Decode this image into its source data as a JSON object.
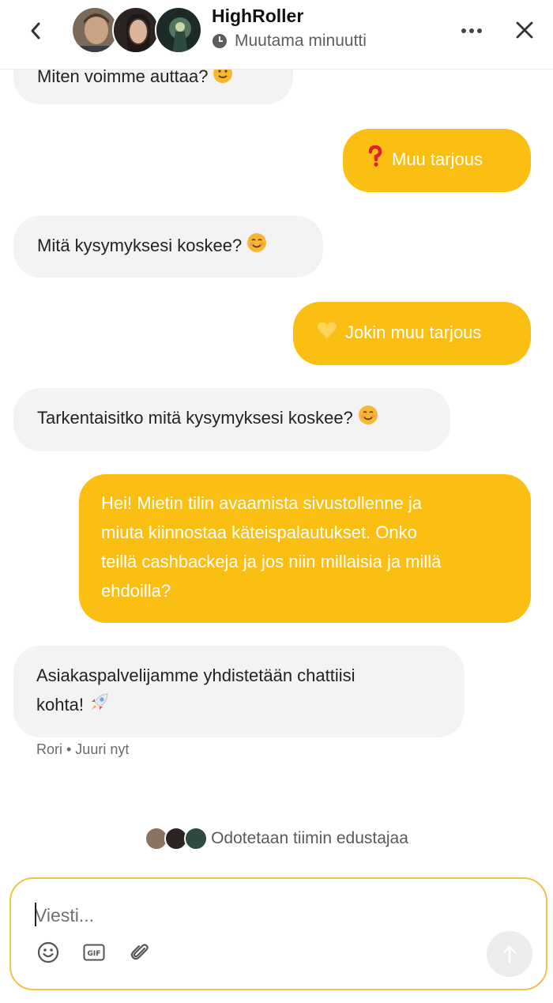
{
  "header": {
    "title": "HighRoller",
    "status": "Muutama minuutti",
    "icons": [
      "chevron-left-icon",
      "clock-icon",
      "more-horizontal-icon",
      "close-icon"
    ]
  },
  "messages": [
    {
      "from": "bot",
      "text": "Miten voimme auttaa?",
      "emoji": "slightly-smiling-face"
    },
    {
      "from": "user",
      "text": "Muu tarjous",
      "emoji": "question-mark"
    },
    {
      "from": "bot",
      "text": "Mitä kysymyksesi koskee?",
      "emoji": "smiling-face"
    },
    {
      "from": "user",
      "text": "Jokin muu tarjous",
      "emoji": "yellow-heart"
    },
    {
      "from": "bot",
      "text": "Tarkentaisitko mitä kysymyksesi koskee?",
      "emoji": "smiling-face"
    },
    {
      "from": "user",
      "lines": [
        "Hei! Mietin tilin avaamista sivustollenne ja",
        "miuta kiinnostaa käteispalautukset. Onko",
        "teillä cashbackeja ja jos niin millaisia ja millä",
        "ehdoilla?"
      ]
    },
    {
      "from": "bot",
      "lines": [
        "Asiakaspalvelijamme yhdistetään chattiisi",
        "kohta!"
      ],
      "emoji": "rocket"
    }
  ],
  "last_meta": "Rori • Juuri nyt",
  "waiting_text": "Odotetaan tiimin edustajaa",
  "composer": {
    "placeholder": "Viesti...",
    "tools": [
      "emoji-icon",
      "gif-icon",
      "paperclip-icon"
    ],
    "send": "send-arrow-icon"
  },
  "colors": {
    "accent": "#fbbf14",
    "bot_bubble": "#f3f3f3",
    "composer_border": "#f3c04a"
  }
}
